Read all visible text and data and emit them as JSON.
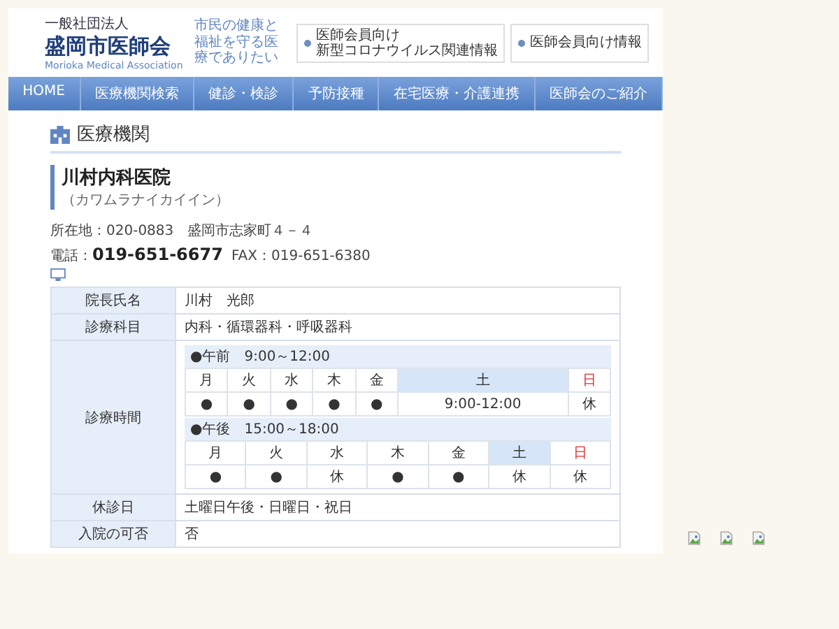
{
  "header": {
    "logo_org": "一般社団法人",
    "logo_name": "盛岡市医師会",
    "logo_en": "Morioka Medical Association",
    "tagline": "市民の健康と福祉を守る医療でありたい",
    "buttons": [
      {
        "lines": [
          "医師会員向け",
          "新型コロナウイルス関連情報"
        ]
      },
      {
        "lines": [
          "医師会員向け情報"
        ]
      }
    ]
  },
  "nav": [
    {
      "label": "HOME"
    },
    {
      "label": "医療機関検索"
    },
    {
      "label": "健診・検診"
    },
    {
      "label": "予防接種"
    },
    {
      "label": "在宅医療・介護連携"
    },
    {
      "label": "医師会のご紹介"
    }
  ],
  "section_title": "医療機関",
  "clinic": {
    "name": "川村内科医院",
    "kana": "（カワムラナイカイイン）",
    "address": "所在地：020-0883　盛岡市志家町４－４",
    "phone_label": "電話：",
    "phone": "019-651-6677",
    "fax": "FAX：019-651-6380"
  },
  "table": [
    {
      "kind": "text",
      "label": "院長氏名",
      "value": "川村　光郎"
    },
    {
      "kind": "text",
      "label": "診療科目",
      "value": "内科・循環器科・呼吸器科"
    },
    {
      "kind": "hours",
      "label": "診療時間",
      "sessions": [
        {
          "title": "●午前　9:00～12:00",
          "days": [
            {
              "label": "月",
              "kind": "weekday"
            },
            {
              "label": "火",
              "kind": "weekday"
            },
            {
              "label": "水",
              "kind": "weekday"
            },
            {
              "label": "木",
              "kind": "weekday"
            },
            {
              "label": "金",
              "kind": "weekday"
            },
            {
              "label": "土",
              "kind": "saturday"
            },
            {
              "label": "日",
              "kind": "sunday"
            }
          ],
          "marks": [
            "●",
            "●",
            "●",
            "●",
            "●",
            "9:00-12:00",
            "休"
          ]
        },
        {
          "title": "●午後　15:00～18:00",
          "days": [
            {
              "label": "月",
              "kind": "weekday"
            },
            {
              "label": "火",
              "kind": "weekday"
            },
            {
              "label": "水",
              "kind": "weekday"
            },
            {
              "label": "木",
              "kind": "weekday"
            },
            {
              "label": "金",
              "kind": "weekday"
            },
            {
              "label": "土",
              "kind": "saturday"
            },
            {
              "label": "日",
              "kind": "sunday"
            }
          ],
          "marks": [
            "●",
            "●",
            "休",
            "●",
            "●",
            "休",
            "休"
          ]
        }
      ]
    },
    {
      "kind": "text",
      "label": "休診日",
      "value": "土曜日午後・日曜日・祝日"
    },
    {
      "kind": "text",
      "label": "入院の可否",
      "value": "否"
    }
  ],
  "broken_images": [
    {
      "kind": "broken"
    },
    {
      "kind": "broken"
    },
    {
      "kind": "broken"
    }
  ]
}
